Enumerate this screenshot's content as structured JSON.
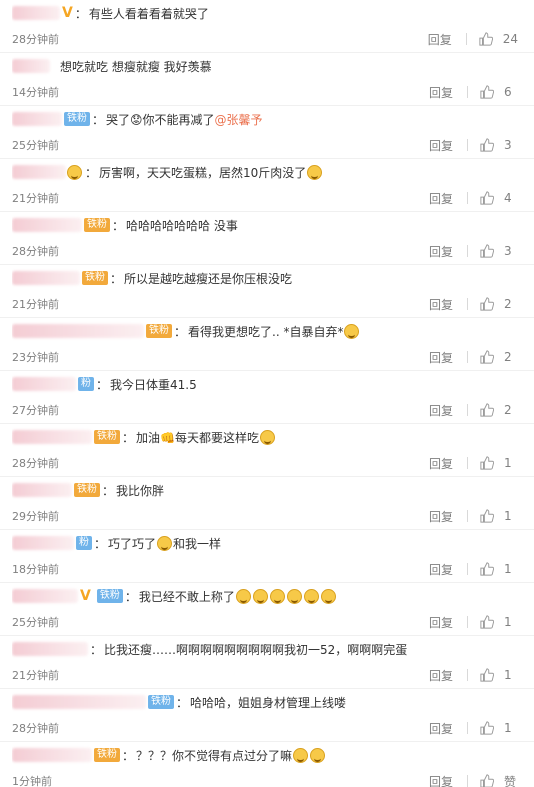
{
  "labels": {
    "reply": "回复",
    "like_zero": "赞"
  },
  "comments": [
    {
      "badge": "V",
      "fan": "",
      "text": "有些人看着看着就哭了",
      "time": "28分钟前",
      "likes": "24"
    },
    {
      "badge": "",
      "fan": "",
      "text": "想吃就吃 想瘦就瘦 我好羡慕",
      "time": "14分钟前",
      "likes": "6"
    },
    {
      "badge": "",
      "fan": "铁粉",
      "text": "哭了😟你不能再减了",
      "mention": "@张馨予",
      "time": "25分钟前",
      "likes": "3"
    },
    {
      "badge": "",
      "fan": "",
      "text": "厉害啊，天天吃蛋糕，居然10斤肉没了",
      "time": "21分钟前",
      "likes": "4"
    },
    {
      "badge": "",
      "fan": "铁粉",
      "text": "哈哈哈哈哈哈哈 没事",
      "time": "28分钟前",
      "likes": "3"
    },
    {
      "badge": "",
      "fan": "铁粉",
      "text": "所以是越吃越瘦还是你压根没吃",
      "time": "21分钟前",
      "likes": "2"
    },
    {
      "badge": "",
      "fan": "铁粉",
      "text": "看得我更想吃了.. *自暴自弃*",
      "time": "23分钟前",
      "likes": "2"
    },
    {
      "badge": "",
      "fan": "粉",
      "text": "我今日体重41.5",
      "time": "27分钟前",
      "likes": "2"
    },
    {
      "badge": "",
      "fan": "铁粉",
      "text": "加油👊每天都要这样吃",
      "time": "28分钟前",
      "likes": "1"
    },
    {
      "badge": "",
      "fan": "铁粉",
      "text": "我比你胖",
      "time": "29分钟前",
      "likes": "1"
    },
    {
      "badge": "",
      "fan": "粉",
      "text": "巧了巧了",
      "text2": "和我一样",
      "time": "18分钟前",
      "likes": "1"
    },
    {
      "badge": "V",
      "fan": "铁粉",
      "text": "我已经不敢上称了",
      "time": "25分钟前",
      "likes": "1"
    },
    {
      "badge": "",
      "fan": "",
      "text": "比我还瘦……啊啊啊啊啊啊啊啊啊我初一52，啊啊啊完蛋",
      "time": "21分钟前",
      "likes": "1"
    },
    {
      "badge": "",
      "fan": "铁粉",
      "text": "哈哈哈，姐姐身材管理上线喽",
      "time": "28分钟前",
      "likes": "1"
    },
    {
      "badge": "",
      "fan": "铁粉",
      "text": "？？？你不觉得有点过分了嘛",
      "time": "1分钟前",
      "likes": "赞"
    }
  ],
  "colors": {
    "link": "#eb7350",
    "fan_blue": "#6fb3ea",
    "fan_orange": "#f2a93b",
    "vip": "#f5a623",
    "meta": "#808080"
  }
}
